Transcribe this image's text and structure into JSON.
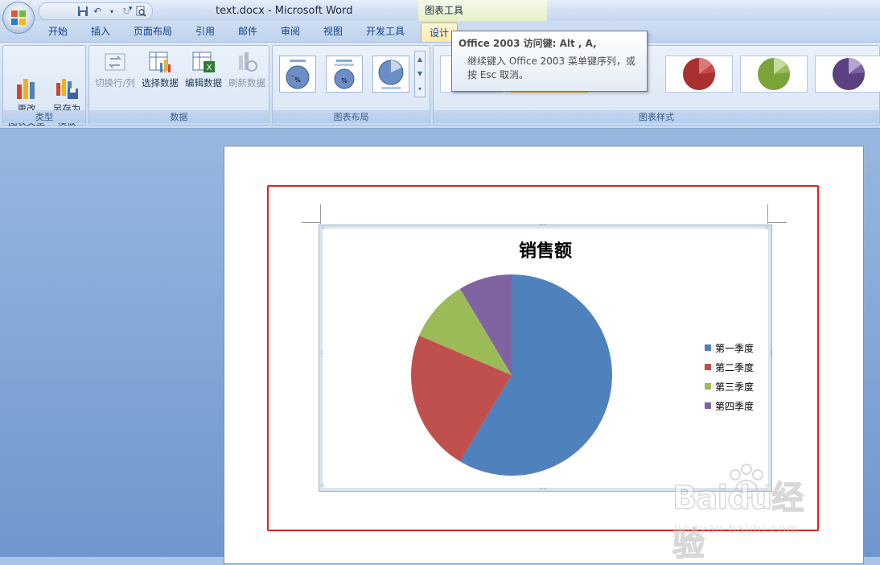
{
  "window": {
    "title": "text.docx - Microsoft Word",
    "context_tool_label": "图表工具"
  },
  "tabs": [
    {
      "label": "开始"
    },
    {
      "label": "插入"
    },
    {
      "label": "页面布局"
    },
    {
      "label": "引用"
    },
    {
      "label": "邮件"
    },
    {
      "label": "审阅"
    },
    {
      "label": "视图"
    },
    {
      "label": "开发工具"
    },
    {
      "label": "设计",
      "active": true
    }
  ],
  "ribbon": {
    "type_group": {
      "label": "类型",
      "change_type": "更改\n图表类型",
      "save_template": "另存为\n模板"
    },
    "data_group": {
      "label": "数据",
      "switch_row_col": "切换行/列",
      "select_data": "选择数据",
      "edit_data": "编辑数据",
      "refresh_data": "刷新数据"
    },
    "layout_group": {
      "label": "图表布局"
    },
    "styles_group": {
      "label": "图表样式"
    }
  },
  "tooltip": {
    "title": "Office 2003 访问键: Alt , A,",
    "body": "继续键入 Office 2003 菜单键序列，或按 Esc 取消。"
  },
  "chart_data": {
    "type": "pie",
    "title": "销售额",
    "categories": [
      "第一季度",
      "第二季度",
      "第三季度",
      "第四季度"
    ],
    "values": [
      8.2,
      3.2,
      1.4,
      1.2
    ],
    "colors": [
      "#4f81bd",
      "#c0504d",
      "#9bbb59",
      "#8064a2"
    ],
    "legend_position": "right"
  },
  "watermark": {
    "brand": "Baidu经验",
    "site": "jingyan.baidu.com"
  }
}
